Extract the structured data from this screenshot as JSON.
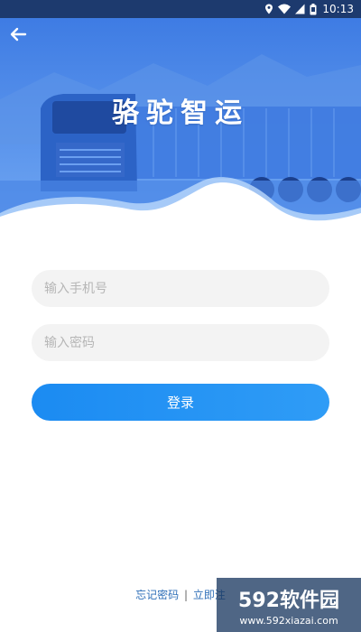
{
  "status_bar": {
    "time": "10:13",
    "icons": [
      "location-icon",
      "wifi-icon",
      "signal-icon",
      "battery-icon"
    ]
  },
  "header": {
    "back_icon": "arrow-left-icon",
    "app_title": "骆驼智运"
  },
  "form": {
    "phone_placeholder": "输入手机号",
    "password_placeholder": "输入密码",
    "login_label": "登录"
  },
  "footer": {
    "forgot_password": "忘记密码",
    "separator": "|",
    "register": "立即注"
  },
  "watermark": {
    "brand": "592软件园",
    "url": "www.592xiazai.com"
  },
  "colors": {
    "accent": "#2196F3",
    "hero_blue": "#4a8cec",
    "input_bg": "#f3f3f3",
    "link": "#2f6fb8"
  }
}
